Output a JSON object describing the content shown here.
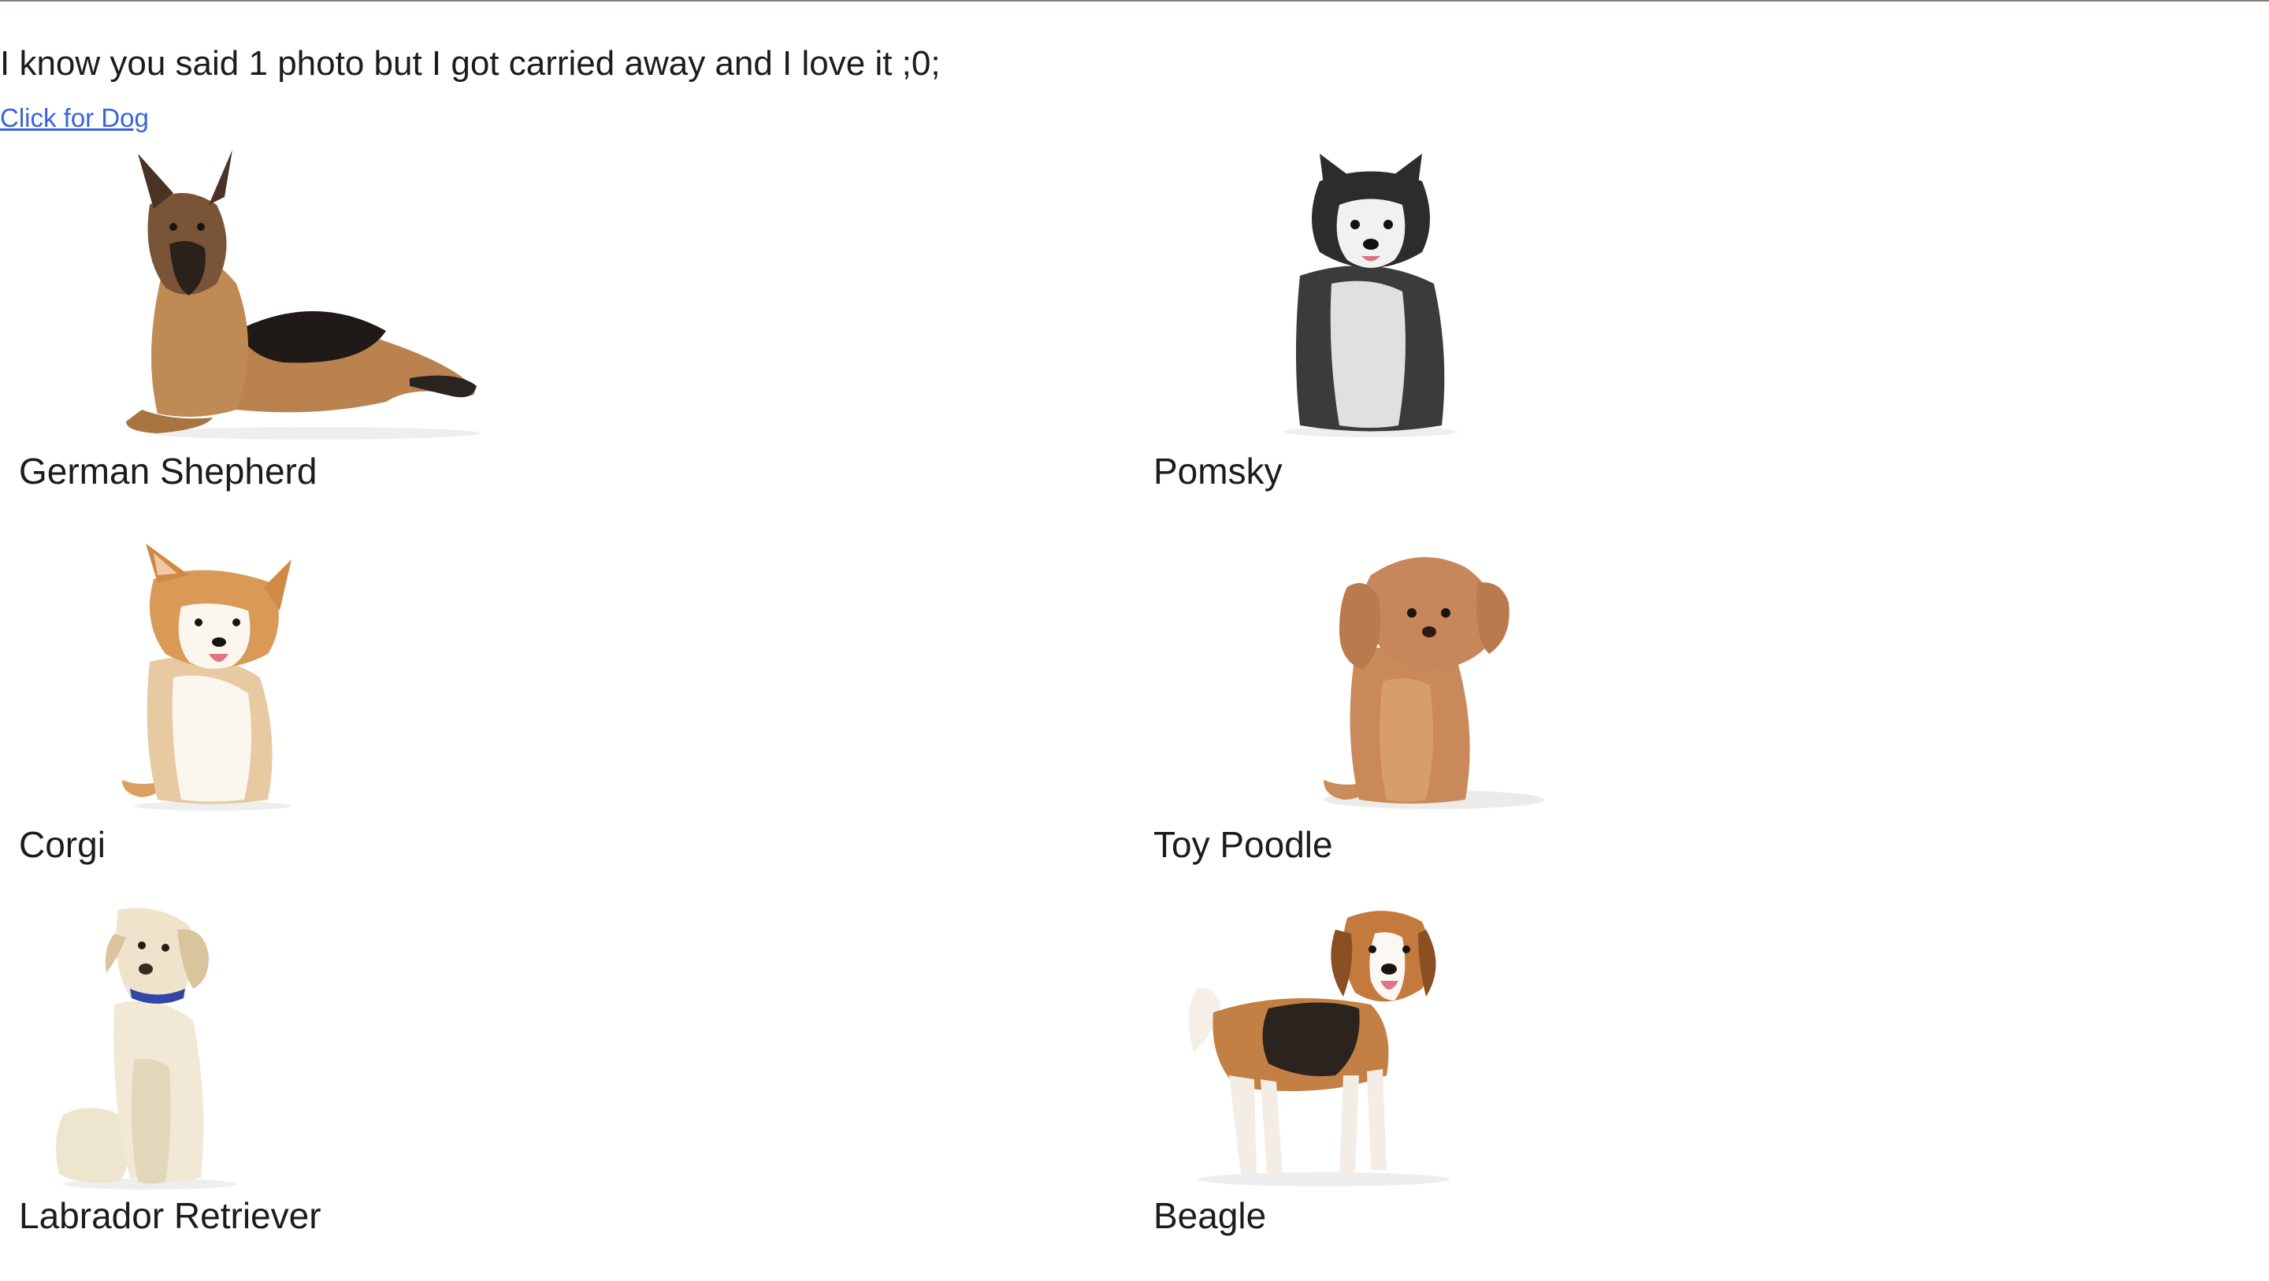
{
  "heading": "I know you said 1 photo but I got carried away and I love it ;0;",
  "link": {
    "label": "Click for Dog"
  },
  "dogs": [
    {
      "name": "German Shepherd",
      "icon": "german-shepherd-photo"
    },
    {
      "name": "Pomsky",
      "icon": "pomsky-photo"
    },
    {
      "name": "Corgi",
      "icon": "corgi-photo"
    },
    {
      "name": "Toy Poodle",
      "icon": "toy-poodle-photo"
    },
    {
      "name": "Labrador Retriever",
      "icon": "labrador-retriever-photo"
    },
    {
      "name": "Beagle",
      "icon": "beagle-photo"
    }
  ],
  "colors": {
    "link": "#3a63d8",
    "text": "#1c1c1e",
    "top_rule": "#8a7d78"
  }
}
